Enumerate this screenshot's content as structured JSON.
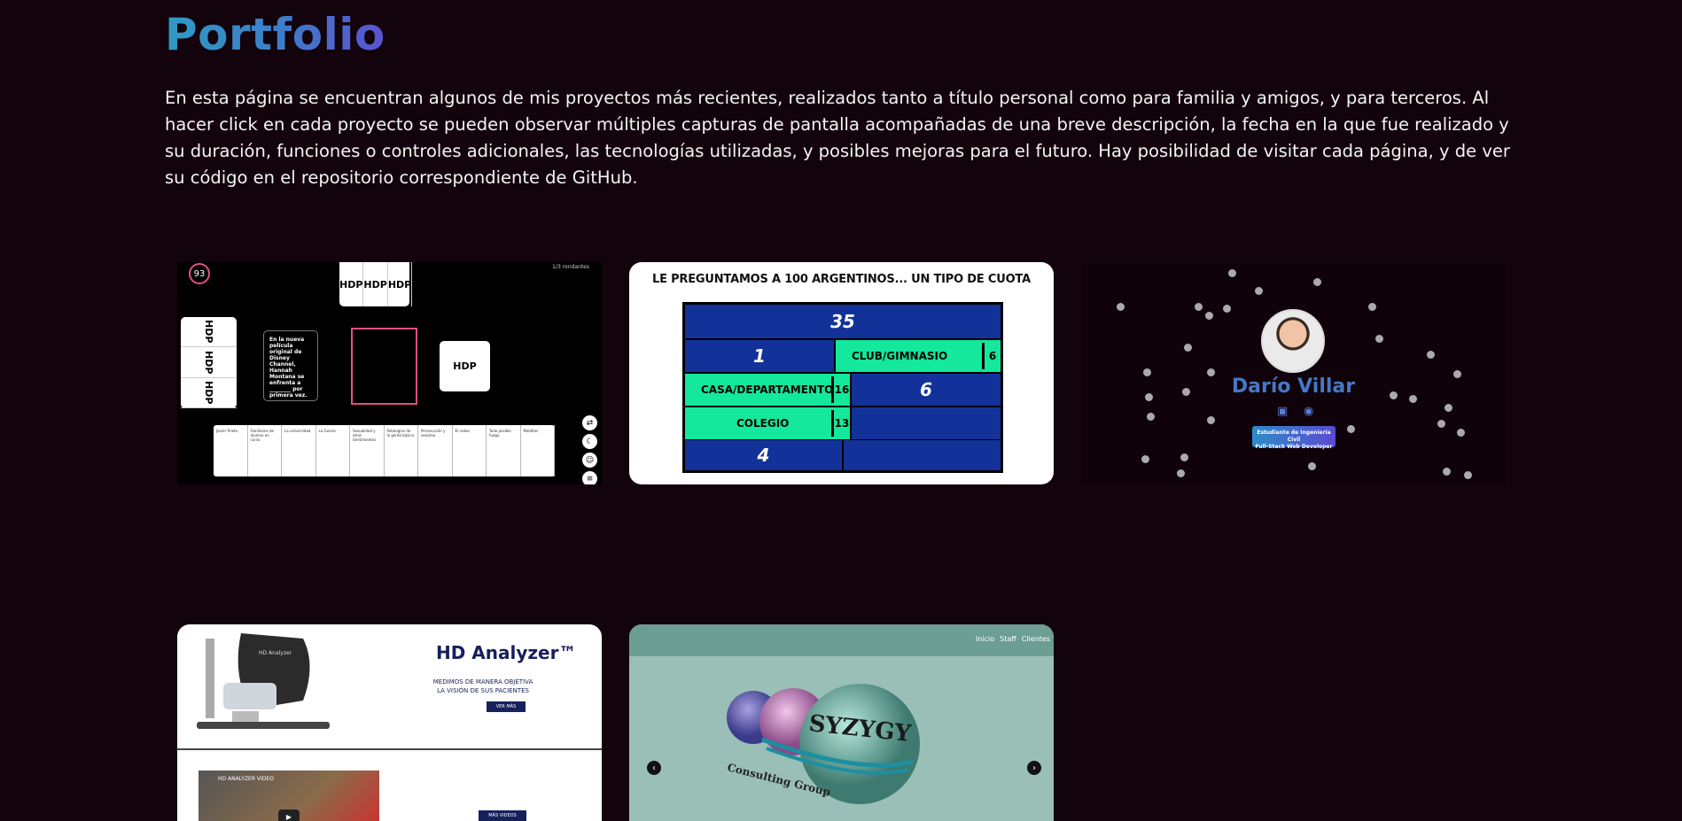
{
  "page": {
    "title": "Portfolio",
    "intro": "En esta página se encuentran algunos de mis proyectos más recientes, realizados tanto a título personal como para familia y amigos, y para terceros. Al hacer click en cada proyecto se pueden observar múltiples capturas de pantalla acompañadas de una breve descripción, la fecha en la que fue realizado y su duración, funciones o controles adicionales, las tecnologías utilizadas, y posibles mejoras para el futuro. Hay posibilidad de visitar cada página, y de ver su código en el repositorio correspondiente de GitHub."
  },
  "projects": [
    {
      "id": "card-game",
      "score": "93",
      "players": "1/3 rondantes",
      "top_cards": [
        "HDP",
        "HDP",
        "HDP"
      ],
      "left_cards": [
        "HDP",
        "HDP",
        "HDP"
      ],
      "black_card": "En la nueva película original de Disney Channel, Hannah Montana se enfrenta a ________ por primera vez.",
      "single_card": "HDP",
      "table_cells": [
        "Javier Prieto",
        "Familiares de alumno en curso",
        "La universidad",
        "La Fuerza",
        "Sexualidad y otros Sentimientos",
        "Patologías de la gente básica",
        "Persecución y sexismo",
        "El rodeo",
        "Todo posible fuego",
        "Malditos"
      ]
    },
    {
      "id": "family-feud",
      "question": "LE PREGUNTAMOS A 100 ARGENTINOS... UN TIPO DE CUOTA",
      "total": "35",
      "rows": [
        {
          "left": "1",
          "right": "CLUB/GIMNASIO",
          "right_points": "6"
        },
        {
          "left": "CASA/DEPARTAMENTO",
          "left_points": "16",
          "right": "6"
        },
        {
          "left": "COLEGIO",
          "left_points": "13",
          "right": ""
        },
        {
          "left": "4",
          "right": ""
        }
      ]
    },
    {
      "id": "personal-site",
      "name": "Darío Villar",
      "badge_line1": "Estudiante de Ingeniería Civil",
      "badge_line2": "Full-Stack Web Developer",
      "linkedin_icon": "linkedin-icon",
      "github_icon": "github-icon"
    },
    {
      "id": "hd-analyzer",
      "brand": "HD Analyzer™",
      "tagline_line1": "MEDIMOS DE MANERA OBJETIVA",
      "tagline_line2": "LA VISIÓN DE SUS PACIENTES",
      "cta": "VER MÁS",
      "video_title": "HD ANALYZER VIDEO",
      "more_videos": "MÁS VIDEOS"
    },
    {
      "id": "syzygy",
      "nav": [
        "Inicio",
        "Staff",
        "Clientes"
      ],
      "logo_text": "SYZYGY",
      "logo_sub": "Consulting Group"
    }
  ]
}
